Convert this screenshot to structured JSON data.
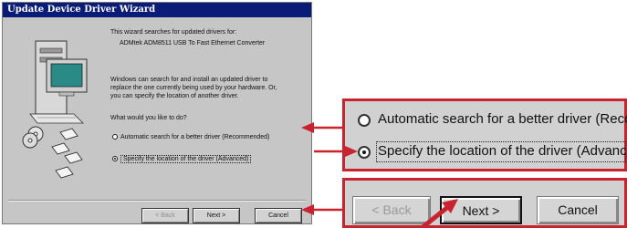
{
  "dialog": {
    "title": "Update Device Driver Wizard",
    "intro": "This wizard searches for updated drivers for:",
    "device": "ADMtek ADM8511 USB To Fast Ethernet Converter",
    "desc_lines": [
      "Windows can search for and install an updated driver to",
      "replace the one currently being used by your hardware. Or,",
      "you can specify the location of another driver."
    ],
    "question": "What would you like to do?",
    "option_auto": "Automatic search for a better driver (Recommended)",
    "option_specify": "Specify the location of the driver (Advanced)",
    "selected_option": "specify",
    "buttons": {
      "back": "< Back",
      "next": "Next >",
      "cancel": "Cancel"
    }
  },
  "zoom_options": {
    "auto": "Automatic search for a better driver (Reco",
    "specify": "Specify the location of the driver (Advanc"
  },
  "zoom_buttons": {
    "back": "< Back",
    "next": "Next >",
    "cancel": "Cancel"
  },
  "colors": {
    "highlight": "#c8232f",
    "titlebar": "#0a1c78",
    "dialog_bg": "#c6c6c6"
  }
}
